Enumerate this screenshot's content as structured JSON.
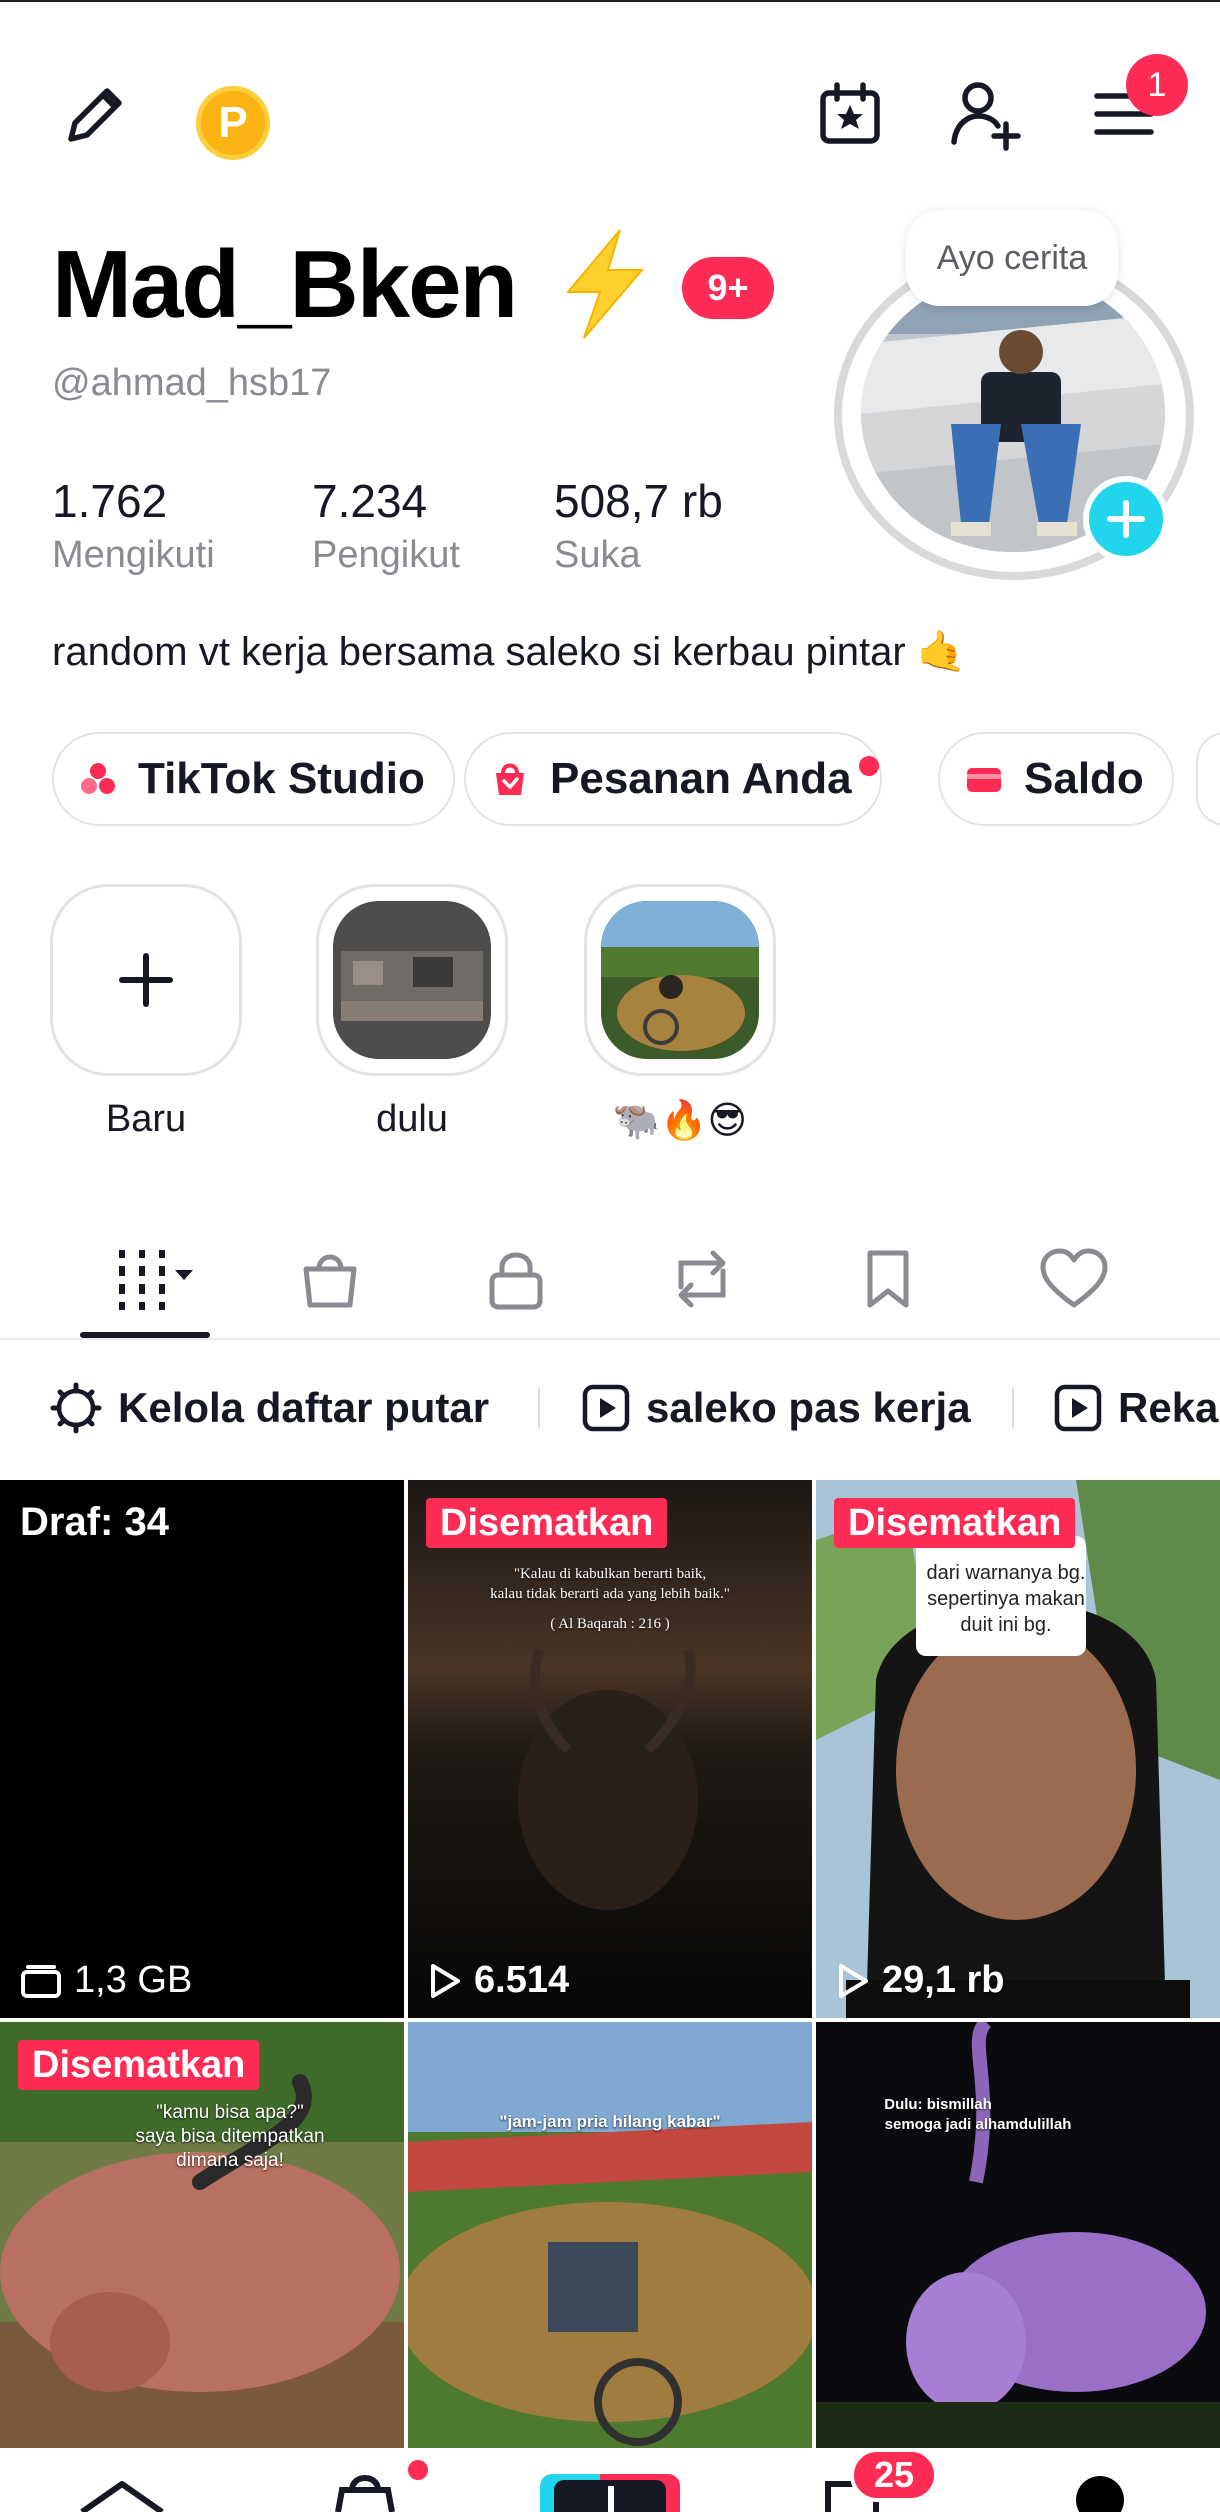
{
  "header": {
    "coin_letter": "P",
    "notification_count": "1"
  },
  "profile": {
    "display_name": "Mad_Bken",
    "level_badge": "9+",
    "username": "@ahmad_hsb17",
    "story_prompt": "Ayo cerita",
    "bio": "random vt kerja bersama saleko si kerbau pintar 🤙",
    "stats": [
      {
        "value": "1.762",
        "label": "Mengikuti"
      },
      {
        "value": "7.234",
        "label": "Pengikut"
      },
      {
        "value": "508,7 rb",
        "label": "Suka"
      }
    ]
  },
  "chips": [
    {
      "label": "TikTok Studio",
      "icon": "studio-icon"
    },
    {
      "label": "Pesanan Anda",
      "icon": "shop-bag-icon"
    },
    {
      "label": "Saldo",
      "icon": "wallet-icon"
    }
  ],
  "highlights": [
    {
      "label": "Baru"
    },
    {
      "label": "dulu"
    },
    {
      "label": "🐃🔥😎"
    }
  ],
  "tabs": [
    {
      "name": "videos-grid-icon"
    },
    {
      "name": "shop-icon"
    },
    {
      "name": "private-lock-icon"
    },
    {
      "name": "repost-icon"
    },
    {
      "name": "bookmark-icon"
    },
    {
      "name": "liked-heart-icon"
    }
  ],
  "playlists": [
    {
      "label": "Kelola daftar putar",
      "icon": "gear-icon"
    },
    {
      "label": "saleko pas kerja",
      "icon": "playlist-play-icon"
    },
    {
      "label": "Reka",
      "icon": "playlist-play-icon"
    }
  ],
  "grid": [
    {
      "badge": "Draf: 34",
      "footer": "1,3 GB"
    },
    {
      "pin": "Disematkan",
      "views": "6.514",
      "caption_1": "\"Kalau di kabulkan berarti baik,",
      "caption_2": "kalau tidak berarti ada yang lebih baik.\"",
      "caption_3": "( Al Baqarah : 216 )"
    },
    {
      "pin": "Disematkan",
      "views": "29,1 rb",
      "caption_1": "dari warnanya bg.",
      "caption_2": "sepertinya makan",
      "caption_3": "duit ini bg."
    },
    {
      "pin": "Disematkan",
      "caption_1": "\"kamu bisa apa?\"",
      "caption_2": "saya bisa ditempatkan",
      "caption_3": "dimana saja!"
    },
    {
      "caption_1": "\"jam-jam pria hilang kabar\""
    },
    {
      "caption_1": "Dulu: bismillah",
      "caption_2": "semoga jadi alhamdulillah"
    }
  ],
  "bottom_nav": {
    "inbox_badge": "25"
  },
  "colors": {
    "accent": "#fe2c55",
    "cyan": "#20d5ec",
    "coin": "#fbb314"
  }
}
